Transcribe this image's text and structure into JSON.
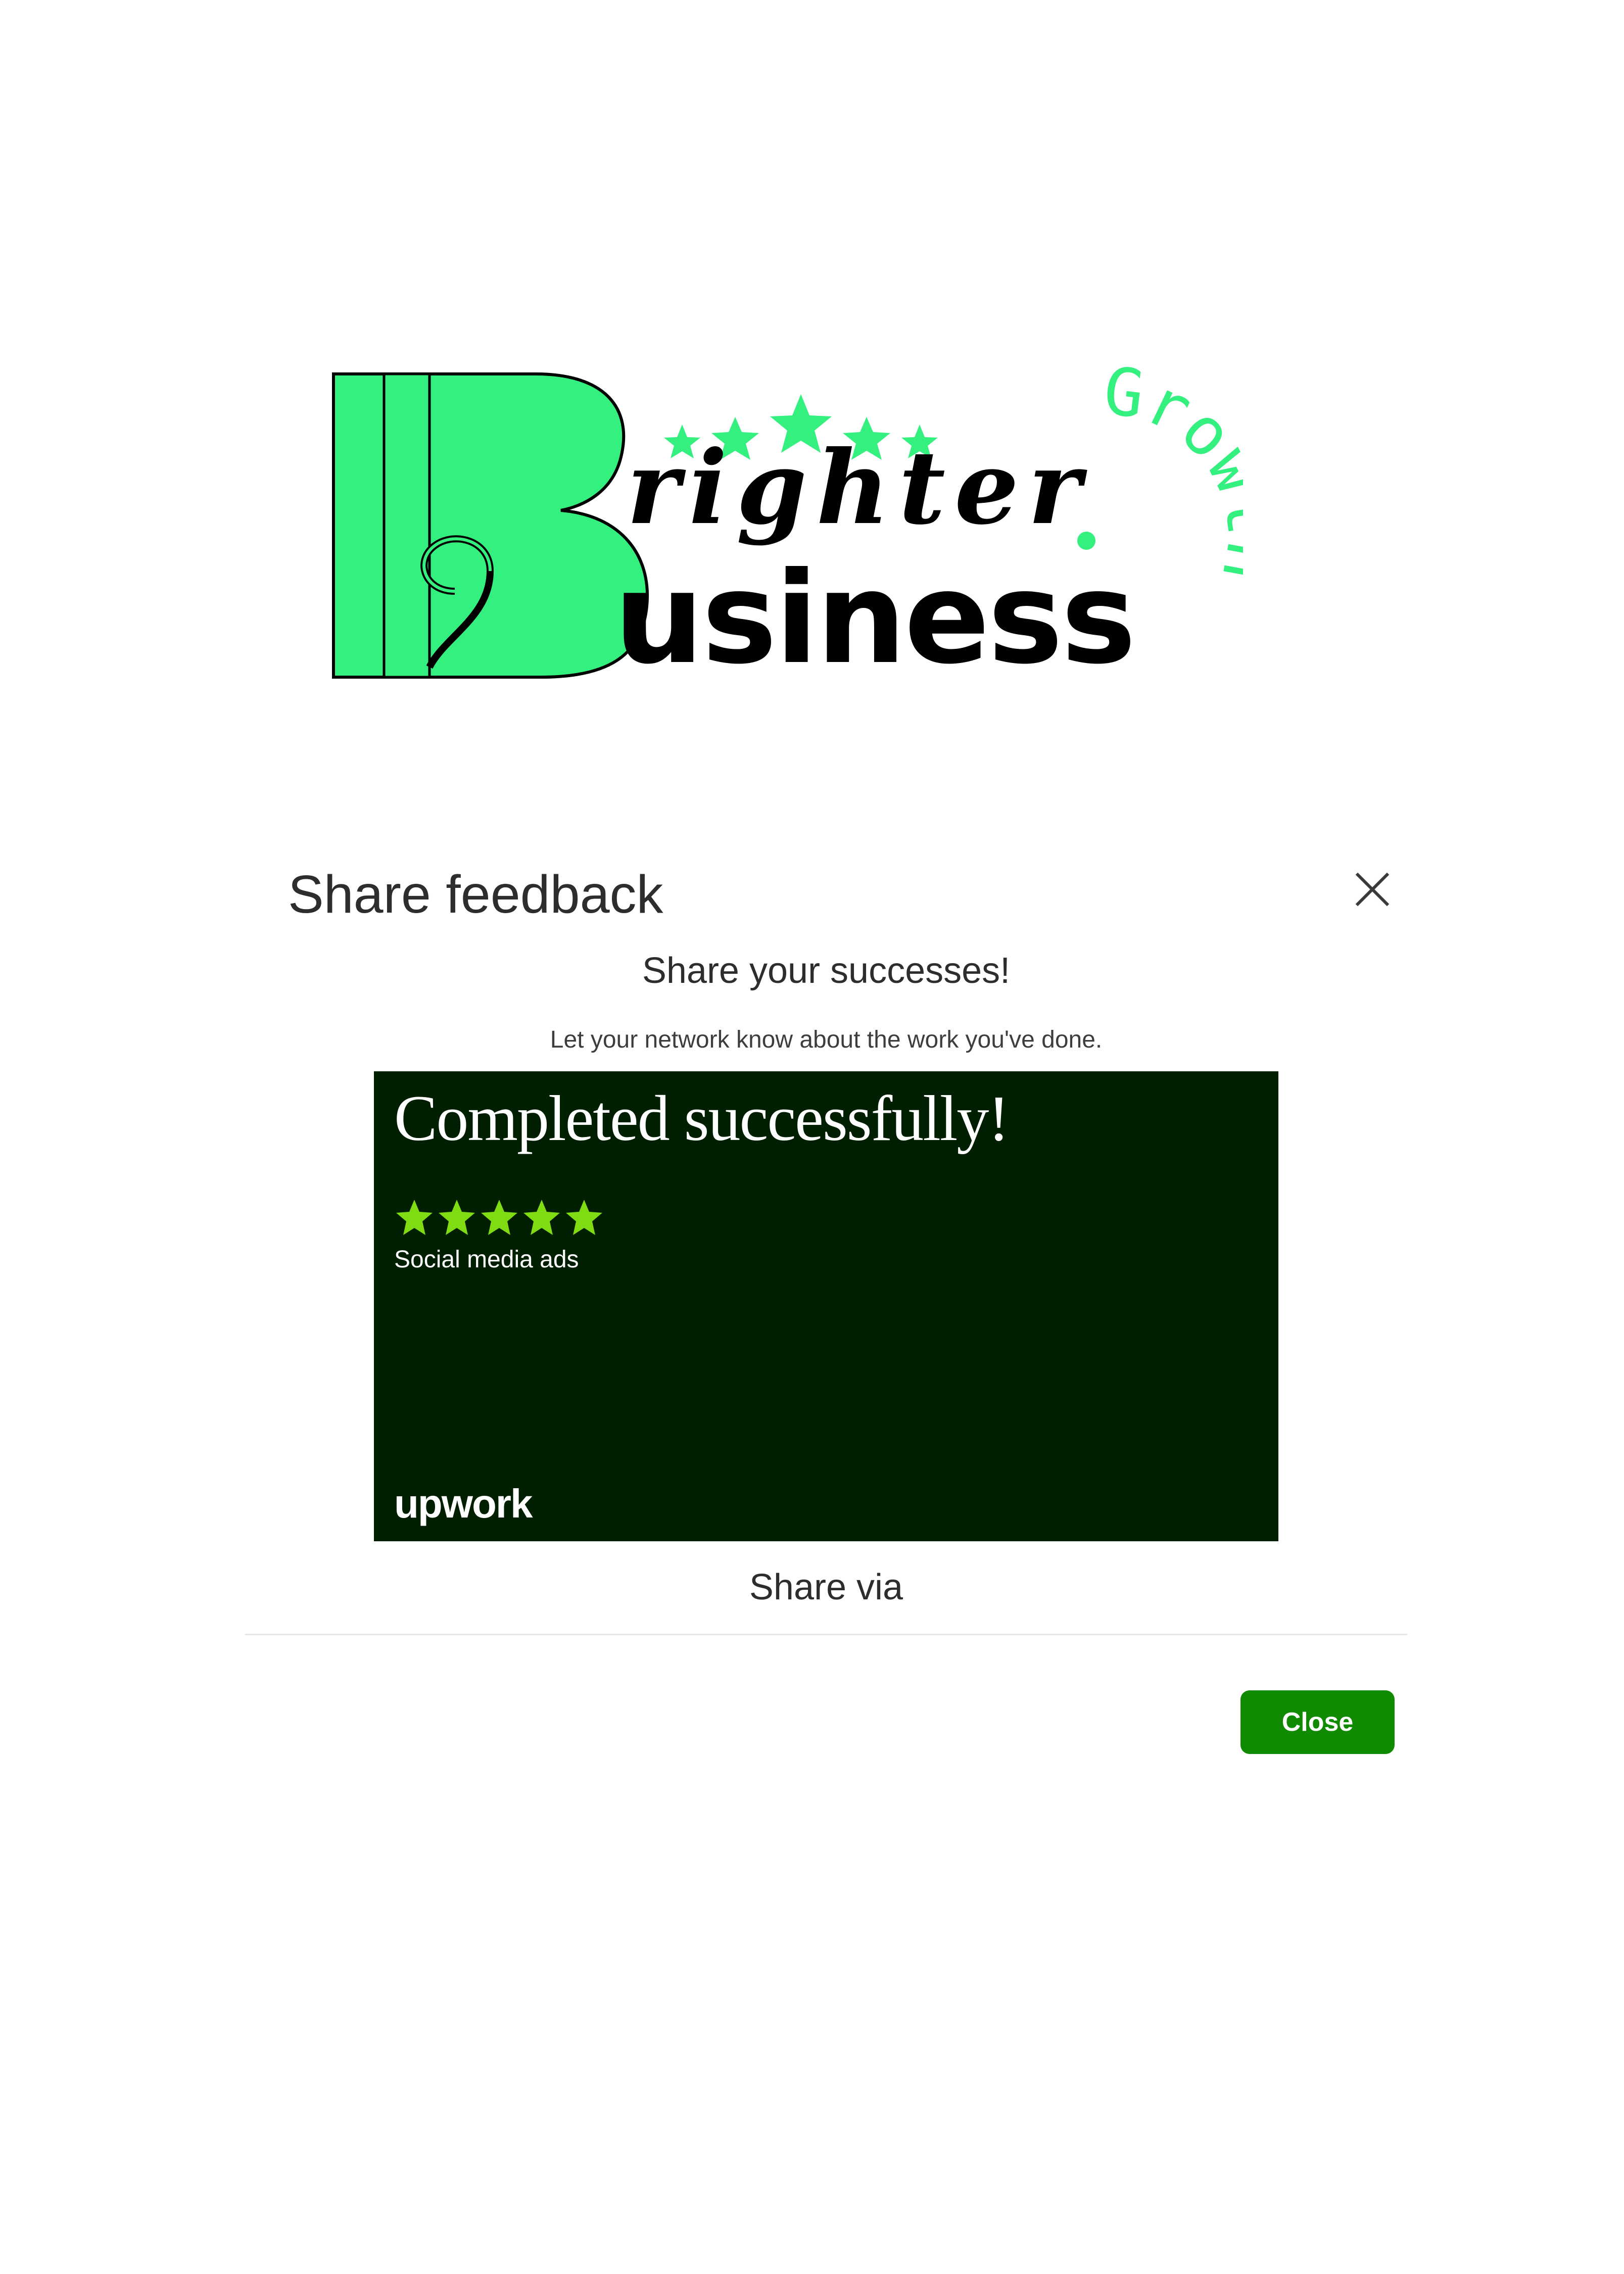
{
  "logo": {
    "line1": "righter",
    "line2": "usiness",
    "initial": "B",
    "tagline": "Growth",
    "colors": {
      "green": "#33f07f",
      "black": "#000000"
    }
  },
  "modal": {
    "title": "Share feedback",
    "subtitle": "Share your successes!",
    "description": "Let your network know about the work you've done.",
    "card": {
      "title": "Completed successfully!",
      "rating": 5,
      "category": "Social media ads",
      "brand": "upwork",
      "colors": {
        "background": "#001e00",
        "stars": "#7fdc13"
      }
    },
    "share_via": "Share via",
    "close_button": "Close",
    "close_icon": "close-icon",
    "colors": {
      "button": "#108a00"
    }
  }
}
